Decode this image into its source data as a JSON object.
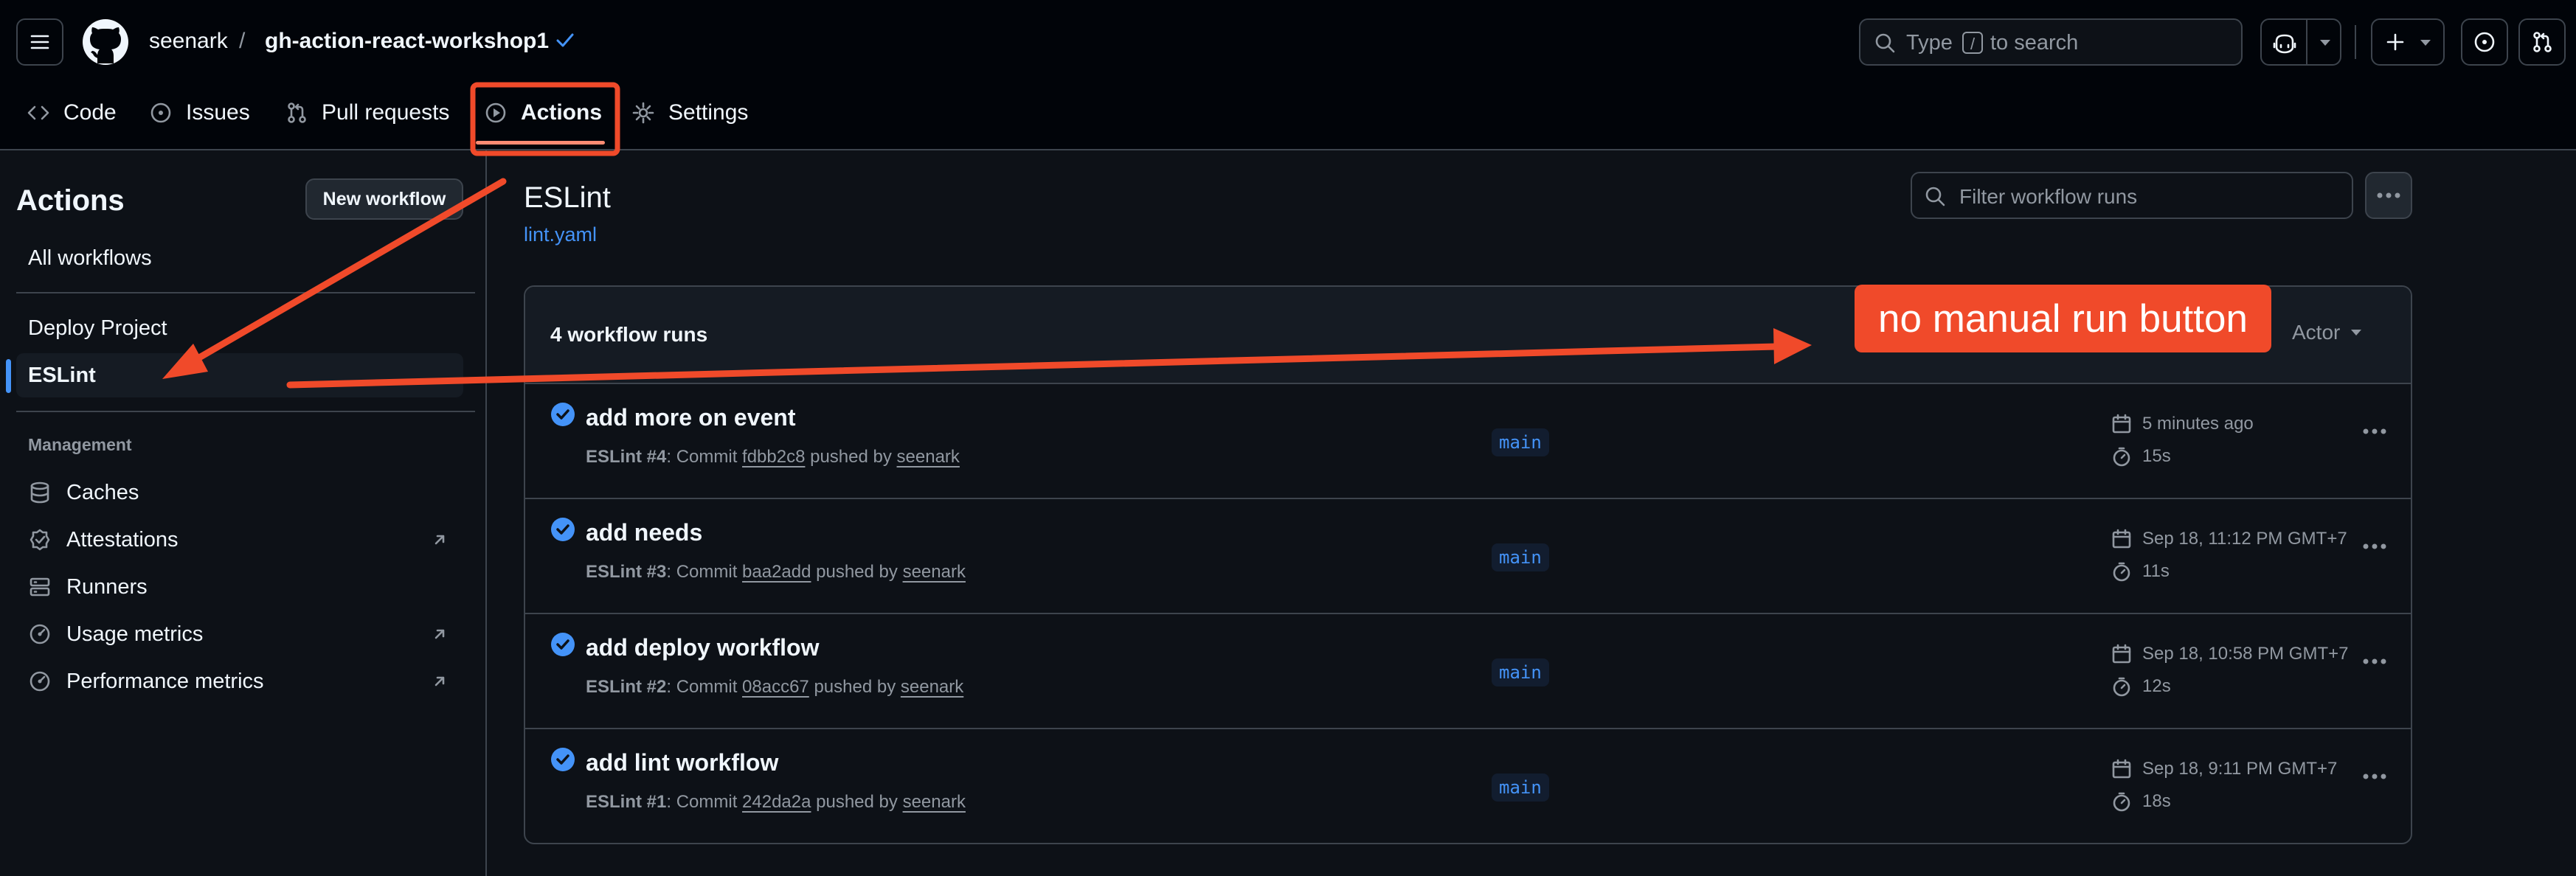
{
  "header": {
    "owner": "seenark",
    "separator": "/",
    "repo": "gh-action-react-workshop1",
    "search": {
      "prefix": "Type",
      "key": "/",
      "suffix": "to search"
    }
  },
  "tabs": [
    {
      "label": "Code"
    },
    {
      "label": "Issues"
    },
    {
      "label": "Pull requests"
    },
    {
      "label": "Actions"
    },
    {
      "label": "Settings"
    }
  ],
  "sidebar": {
    "title": "Actions",
    "new_workflow": "New workflow",
    "all_workflows": "All workflows",
    "workflows": [
      "Deploy Project",
      "ESLint"
    ],
    "management_heading": "Management",
    "management": [
      "Caches",
      "Attestations",
      "Runners",
      "Usage metrics",
      "Performance metrics"
    ]
  },
  "main": {
    "workflow_title": "ESLint",
    "workflow_file": "lint.yaml",
    "filter_placeholder": "Filter workflow runs",
    "runs_count": "4 workflow runs",
    "actor_filter": "Actor",
    "runs": [
      {
        "title": "add more on event",
        "workflow": "ESLint #4",
        "commit_prefix": ": Commit ",
        "commit": "fdbb2c8",
        "pushed_by": " pushed by ",
        "user": "seenark",
        "branch": "main",
        "date": "5 minutes ago",
        "duration": "15s"
      },
      {
        "title": "add needs",
        "workflow": "ESLint #3",
        "commit_prefix": ": Commit ",
        "commit": "baa2add",
        "pushed_by": " pushed by ",
        "user": "seenark",
        "branch": "main",
        "date": "Sep 18, 11:12 PM GMT+7",
        "duration": "11s"
      },
      {
        "title": "add deploy workflow",
        "workflow": "ESLint #2",
        "commit_prefix": ": Commit ",
        "commit": "08acc67",
        "pushed_by": " pushed by ",
        "user": "seenark",
        "branch": "main",
        "date": "Sep 18, 10:58 PM GMT+7",
        "duration": "12s"
      },
      {
        "title": "add lint workflow",
        "workflow": "ESLint #1",
        "commit_prefix": ": Commit ",
        "commit": "242da2a",
        "pushed_by": " pushed by ",
        "user": "seenark",
        "branch": "main",
        "date": "Sep 18, 9:11 PM GMT+7",
        "duration": "18s"
      }
    ]
  },
  "annotation": {
    "label": "no manual run button",
    "color": "#f04a2a"
  },
  "colors": {
    "background": "#0d1117",
    "header_bg": "#010409",
    "border": "#3d444d",
    "accent": "#4493f8",
    "tab_underline": "#fd8c73",
    "success": "#4493f8"
  }
}
